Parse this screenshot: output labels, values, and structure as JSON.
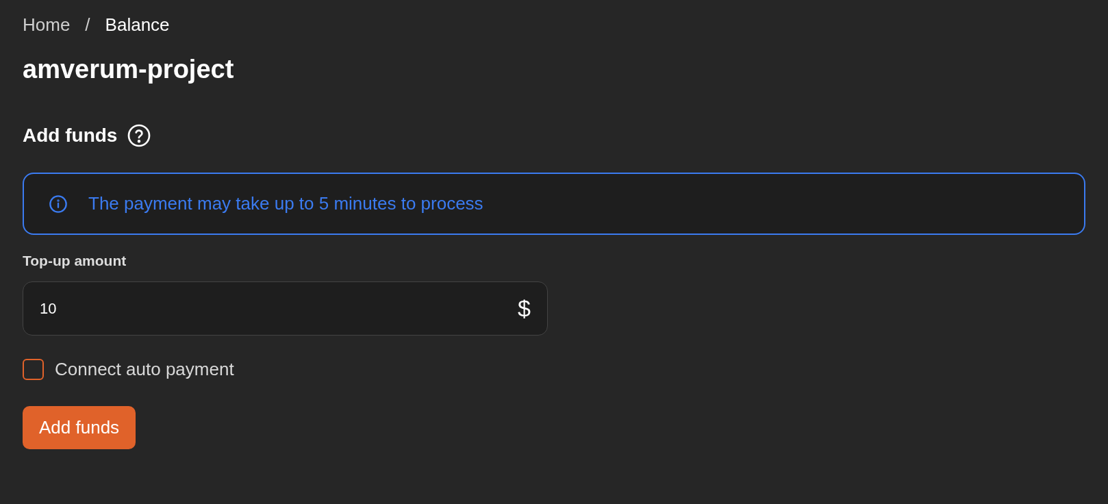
{
  "breadcrumb": [
    "Home",
    "/",
    "Balance"
  ],
  "title": "amverum-project",
  "section": {
    "heading": "Add funds"
  },
  "alert": {
    "text": "The payment may take up to 5 minutes to process"
  },
  "amount": {
    "label": "Top-up amount",
    "value": "10",
    "currency": "$"
  },
  "auto_payment": {
    "label": "Connect auto payment",
    "checked": false
  },
  "submit": {
    "label": "Add funds"
  }
}
